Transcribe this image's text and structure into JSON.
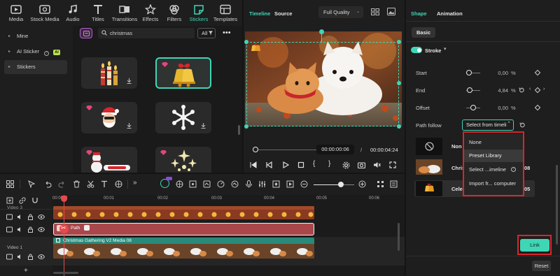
{
  "toolbar": {
    "items": [
      {
        "label": "Media",
        "icon": "media-icon"
      },
      {
        "label": "Stock Media",
        "icon": "stock-media-icon"
      },
      {
        "label": "Audio",
        "icon": "audio-icon"
      },
      {
        "label": "Titles",
        "icon": "titles-icon"
      },
      {
        "label": "Transitions",
        "icon": "transitions-icon"
      },
      {
        "label": "Effects",
        "icon": "effects-icon"
      },
      {
        "label": "Filters",
        "icon": "filters-icon"
      },
      {
        "label": "Stickers",
        "icon": "stickers-icon",
        "active": true
      },
      {
        "label": "Templates",
        "icon": "templates-icon"
      }
    ],
    "accent": "#3fd6b6"
  },
  "leftnav": {
    "items": [
      {
        "label": "Mine"
      },
      {
        "label": "AI Sticker",
        "badge": "AI"
      },
      {
        "label": "Stickers",
        "selected": true
      }
    ]
  },
  "search": {
    "value": "christmas",
    "filter_label": "All"
  },
  "preview": {
    "tab_timeline": "Timeline",
    "tab_source": "Source",
    "quality": "Full Quality",
    "current_time": "00:00:00:06",
    "separator": "/",
    "total_time": "00:00:04:24"
  },
  "props": {
    "tab_shape": "Shape",
    "tab_animation": "Animation",
    "sub_basic": "Basic",
    "stroke_label": "Stroke",
    "start": {
      "label": "Start",
      "value": "0,00",
      "unit": "%",
      "fraction": 0.0
    },
    "end": {
      "label": "End",
      "value": "4,84",
      "unit": "%",
      "fraction": 0.0484
    },
    "offset": {
      "label": "Offset",
      "value": "0,00",
      "unit": "%"
    },
    "path_follow": {
      "label": "Path follow",
      "select_value": "Select from timeli"
    },
    "dropdown": {
      "items": [
        "None",
        "Preset Library",
        "Select ...imeline",
        "Import fr... computer"
      ],
      "highlighted": 1
    },
    "list": [
      {
        "name": "Non"
      },
      {
        "name": "Chris",
        "suffix": "08"
      },
      {
        "name": "Cele",
        "suffix": "05"
      }
    ],
    "link_label": "Link",
    "reset_label": "Reset",
    "highlight_color": "#d8262b"
  },
  "timeline": {
    "ticks": [
      "00:00",
      "00:01",
      "00:02",
      "00:03",
      "00:04",
      "00:05",
      "00:06"
    ],
    "track_video3": "Video 3",
    "track_video1": "Video 1",
    "clip_path": "Path",
    "clip_gathering": "Christmas Gathering V2 Media 08"
  }
}
